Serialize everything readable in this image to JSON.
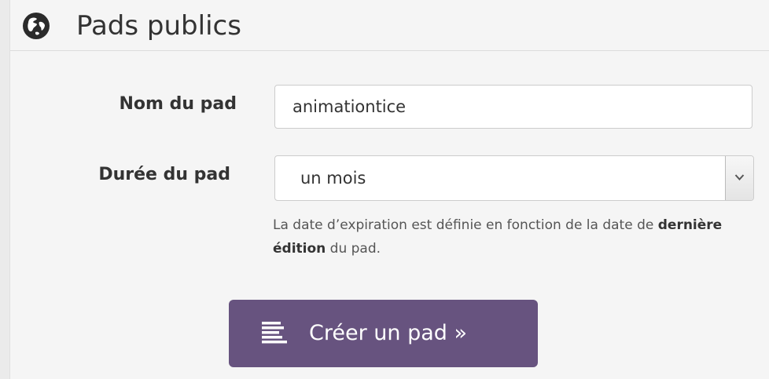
{
  "header": {
    "title": "Pads publics",
    "icon": "globe-icon"
  },
  "form": {
    "name_label": "Nom du pad",
    "name_value": "animationtice",
    "duration_label": "Durée du pad",
    "duration_value": "un mois",
    "help_before": "La date d’expiration est définie en fonction de la date de ",
    "help_bold": "dernière édition",
    "help_after": " du pad."
  },
  "submit": {
    "label": "Créer un pad »",
    "icon": "text-lines-icon"
  },
  "colors": {
    "button": "#67537f",
    "panel": "#f5f5f5"
  }
}
